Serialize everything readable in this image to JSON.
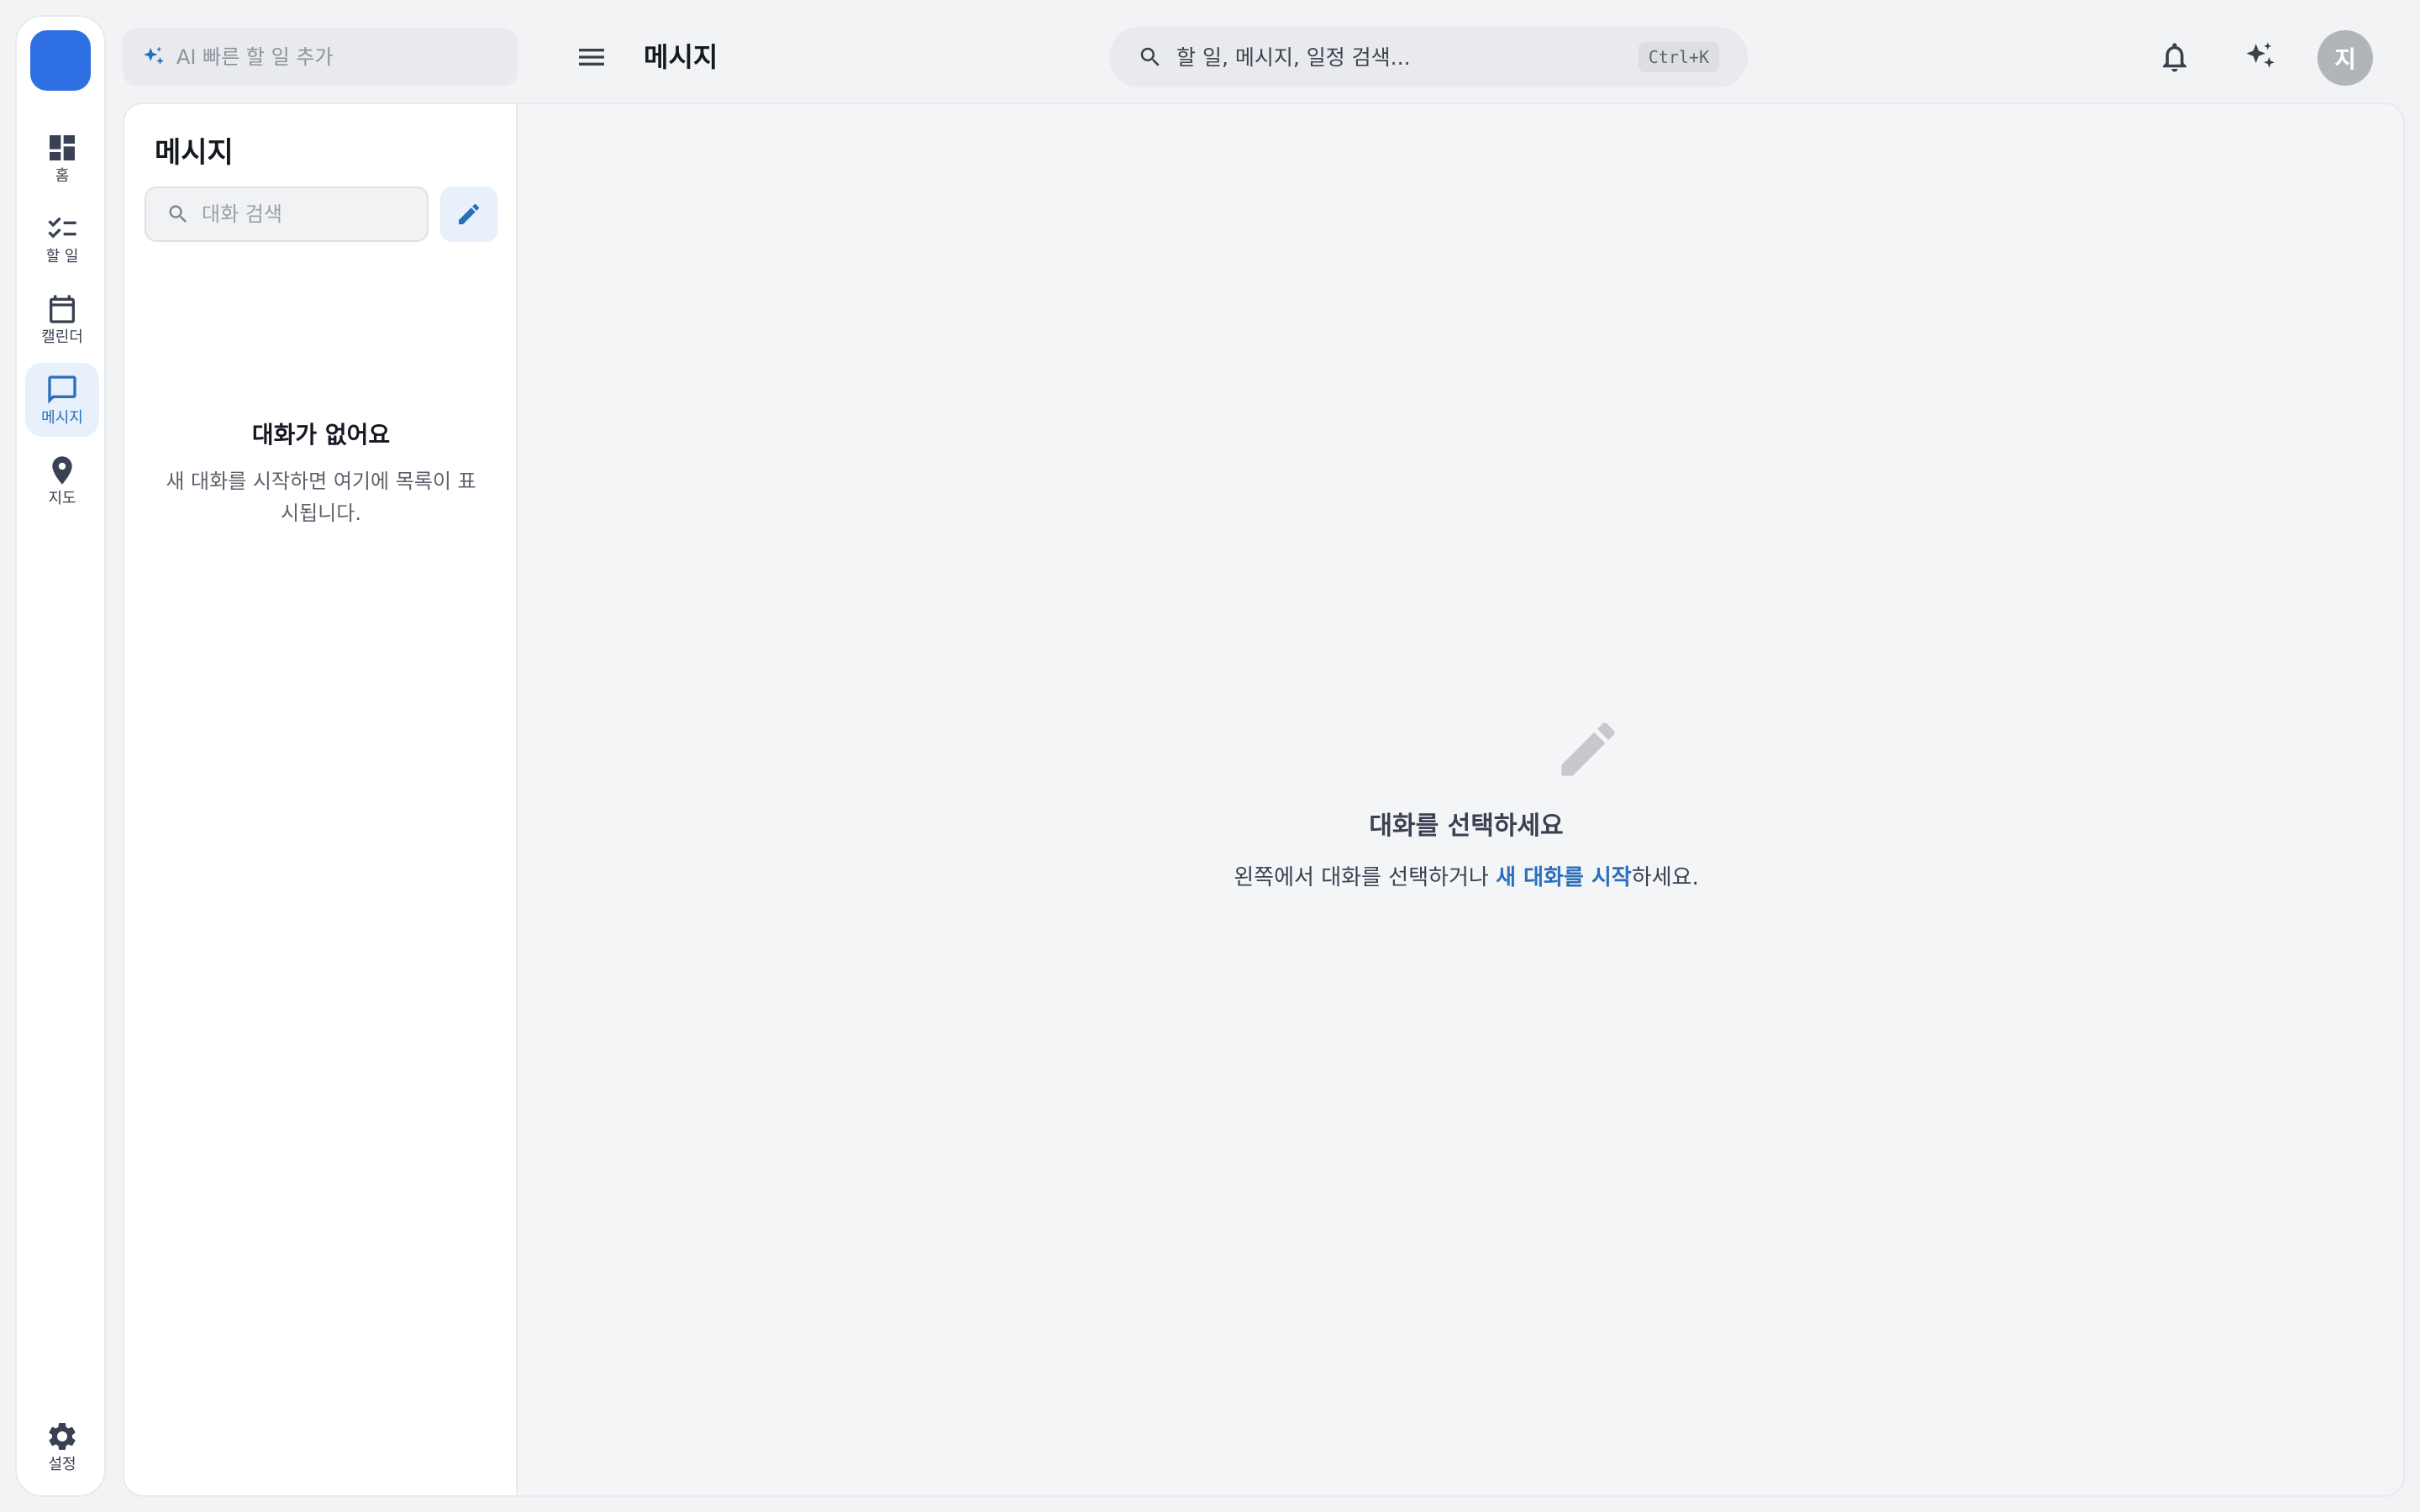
{
  "rail": {
    "items": [
      {
        "id": "home",
        "label": "홈",
        "icon": "dashboard-icon"
      },
      {
        "id": "todo",
        "label": "할 일",
        "icon": "checklist-icon"
      },
      {
        "id": "calendar",
        "label": "캘린더",
        "icon": "calendar-icon"
      },
      {
        "id": "messages",
        "label": "메시지",
        "icon": "chat-icon",
        "active": true
      },
      {
        "id": "map",
        "label": "지도",
        "icon": "map-pin-icon"
      }
    ],
    "settings_label": "설정"
  },
  "topbar": {
    "ai_quick_add_placeholder": "AI 빠른 할 일 추가",
    "page_title": "메시지",
    "search_placeholder": "할 일, 메시지, 일정 검색...",
    "search_shortcut": "Ctrl+K",
    "avatar_initial": "지"
  },
  "conversations": {
    "title": "메시지",
    "search_placeholder": "대화 검색",
    "empty_title": "대화가 없어요",
    "empty_desc": "새 대화를 시작하면 여기에 목록이 표시됩니다."
  },
  "detail": {
    "empty_title": "대화를 선택하세요",
    "empty_desc_before": "왼쪽에서 대화를 선택하거나 ",
    "empty_desc_link": "새 대화를 시작",
    "empty_desc_after": "하세요."
  },
  "colors": {
    "accent": "#2a6fbb",
    "logo": "#2f6fe4",
    "active_bg": "#e7f0fb"
  }
}
